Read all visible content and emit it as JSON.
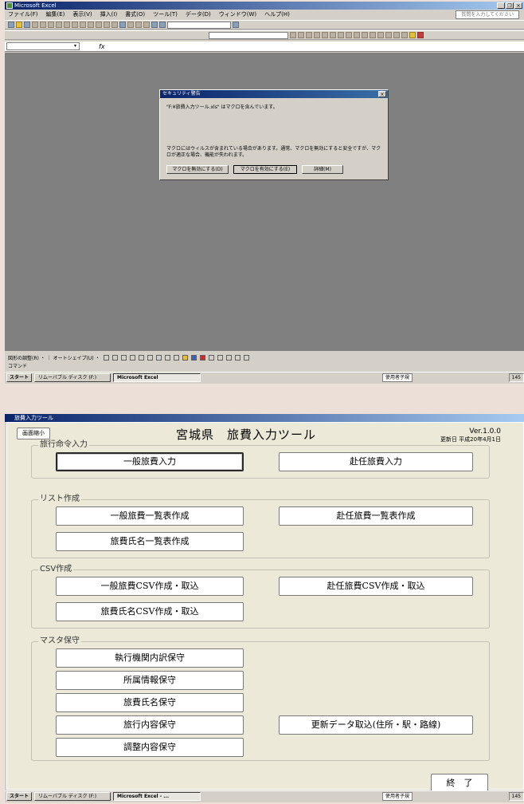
{
  "shot1": {
    "title": "Microsoft Excel",
    "menu": [
      "ファイル(F)",
      "編集(E)",
      "表示(V)",
      "挿入(I)",
      "書式(O)",
      "ツール(T)",
      "データ(D)",
      "ウィンドウ(W)",
      "ヘルプ(H)"
    ],
    "help_placeholder": "質問を入力してください",
    "fx": "fx",
    "dialog": {
      "title": "セキュリティ警告",
      "message": "\"F:¥旅費入力ツール.xls\" はマクロを含んでいます。",
      "warning": "マクロにはウィルスが含まれている場合があります。通常、マクロを無効にすると安全ですが、マクロが適正な場合、機能が失われます。",
      "buttons": [
        "マクロを無効にする(D)",
        "マクロを有効にする(E)",
        "詳細(M)"
      ]
    },
    "drawbar": "図形の調整(R) ・ ｜ オートシェイプ(U) ・",
    "status": "コマンド",
    "taskbar": {
      "start": "スタート",
      "task1": "リムーバブル ディスク (F:)",
      "task2": "Microsoft Excel",
      "ime": "使用者子規",
      "clock": "145"
    }
  },
  "shot2": {
    "window_title": "旅費入力ツール",
    "min_button": "画面縮小",
    "app_title": "宮城県　旅費入力ツール",
    "version": "Ver.1.0.0",
    "updated": "更新日 平成20年4月1日",
    "groups": [
      {
        "label": "旅行命令入力",
        "buttons": [
          "一般旅費入力",
          "赴任旅費入力"
        ]
      },
      {
        "label": "リスト作成",
        "buttons": [
          "一般旅費一覧表作成",
          "赴任旅費一覧表作成",
          "旅費氏名一覧表作成"
        ]
      },
      {
        "label": "CSV作成",
        "buttons": [
          "一般旅費CSV作成・取込",
          "赴任旅費CSV作成・取込",
          "旅費氏名CSV作成・取込"
        ]
      },
      {
        "label": "マスタ保守",
        "buttons": [
          "執行機関内訳保守",
          "所属情報保守",
          "旅費氏名保守",
          "旅行内容保守",
          "調整内容保守",
          "更新データ取込(住所・駅・路線)"
        ]
      }
    ],
    "exit_button": "終　了",
    "taskbar": {
      "start": "スタート",
      "task1": "リムーバブル ディスク (F:)",
      "task2": "Microsoft Excel - ...",
      "ime": "使用者子規",
      "clock": "145"
    }
  }
}
